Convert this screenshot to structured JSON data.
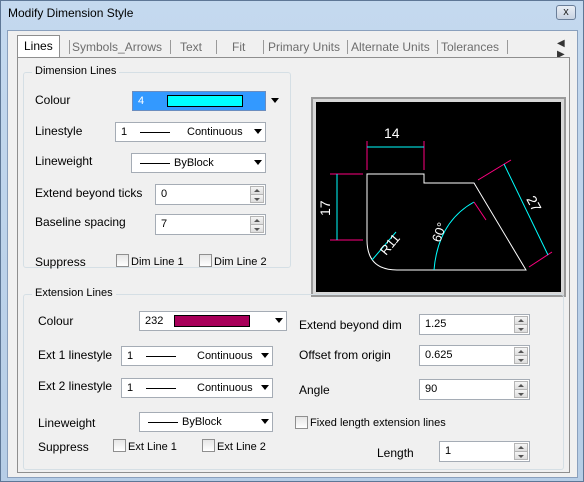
{
  "window": {
    "title": "Modify Dimension Style",
    "close_glyph": "x"
  },
  "tabs": [
    "Lines",
    "Symbols_Arrows",
    "Text",
    "Fit",
    "Primary Units",
    "Alternate Units",
    "Tolerances"
  ],
  "tab_arrows": "◀ ▶",
  "dimension_lines": {
    "title": "Dimension Lines",
    "colour_label": "Colour",
    "colour_value": "4",
    "colour_hex": "#00ffff",
    "linestyle_label": "Linestyle",
    "linestyle_number": "1",
    "linestyle_name": "Continuous",
    "lineweight_label": "Lineweight",
    "lineweight_name": "ByBlock",
    "extend_label": "Extend beyond ticks",
    "extend_value": "0",
    "baseline_label": "Baseline spacing",
    "baseline_value": "7",
    "suppress_label": "Suppress",
    "dim_line_1": "Dim Line 1",
    "dim_line_2": "Dim Line 2"
  },
  "preview": {
    "dim_top": "14",
    "dim_left": "17",
    "dim_diag": "27",
    "dim_radius": "R11",
    "dim_angle": "60°"
  },
  "extension_lines": {
    "title": "Extension Lines",
    "colour_label": "Colour",
    "colour_value": "232",
    "colour_hex": "#a8005a",
    "ext1_label": "Ext 1 linestyle",
    "ext1_number": "1",
    "ext1_name": "Continuous",
    "ext2_label": "Ext 2 linestyle",
    "ext2_number": "1",
    "ext2_name": "Continuous",
    "lineweight_label": "Lineweight",
    "lineweight_name": "ByBlock",
    "suppress_label": "Suppress",
    "ext_line_1": "Ext Line 1",
    "ext_line_2": "Ext Line 2",
    "extend_dim_label": "Extend beyond dim",
    "extend_dim_value": "1.25",
    "offset_label": "Offset from origin",
    "offset_value": "0.625",
    "angle_label": "Angle",
    "angle_value": "90",
    "fixed_label": "Fixed length extension lines",
    "length_label": "Length",
    "length_value": "1"
  }
}
